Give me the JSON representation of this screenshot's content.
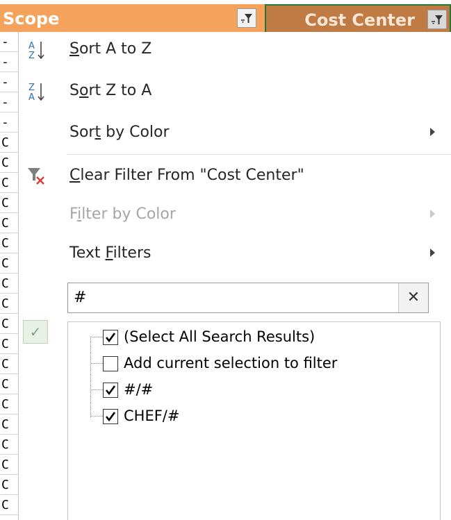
{
  "header": {
    "scope_label": "Scope",
    "cost_center_label": "Cost Center"
  },
  "left_strip": {
    "glyphs": [
      "-",
      "-",
      "-",
      "-",
      "-",
      "C",
      "C",
      "C",
      "C",
      "C",
      "C",
      "C",
      "C",
      "C",
      "C",
      "C",
      "C",
      "C",
      "C",
      "C",
      "C",
      "C",
      "C",
      "C"
    ]
  },
  "menu": {
    "sort_a_z": {
      "pre": "",
      "u": "S",
      "post": "ort A to Z"
    },
    "sort_z_a": {
      "pre": "S",
      "u": "o",
      "post": "rt Z to A"
    },
    "sort_by_color": {
      "pre": "Sor",
      "u": "t",
      "post": " by Color"
    },
    "clear_filter": {
      "pre": "",
      "u": "C",
      "post": "lear Filter From \"Cost Center\""
    },
    "filter_by_color": {
      "pre": "F",
      "u": "i",
      "post": "lter by Color"
    },
    "text_filters": {
      "pre": "Text ",
      "u": "F",
      "post": "ilters"
    }
  },
  "search": {
    "value": "#",
    "clear_symbol": "✕"
  },
  "side_check_symbol": "✓",
  "tree": {
    "items": [
      {
        "label": "(Select All Search Results)",
        "checked": true
      },
      {
        "label": "Add current selection to filter",
        "checked": false
      },
      {
        "label": "#/#",
        "checked": true
      },
      {
        "label": "CHEF/#",
        "checked": true
      }
    ]
  },
  "colors": {
    "scope_header_bg": "#f5a25d",
    "cost_header_bg": "#c07b45",
    "selected_border": "#1f7a3a",
    "clear_filter_x": "#e03a2f",
    "sort_icon_blue": "#2e6fb5"
  }
}
